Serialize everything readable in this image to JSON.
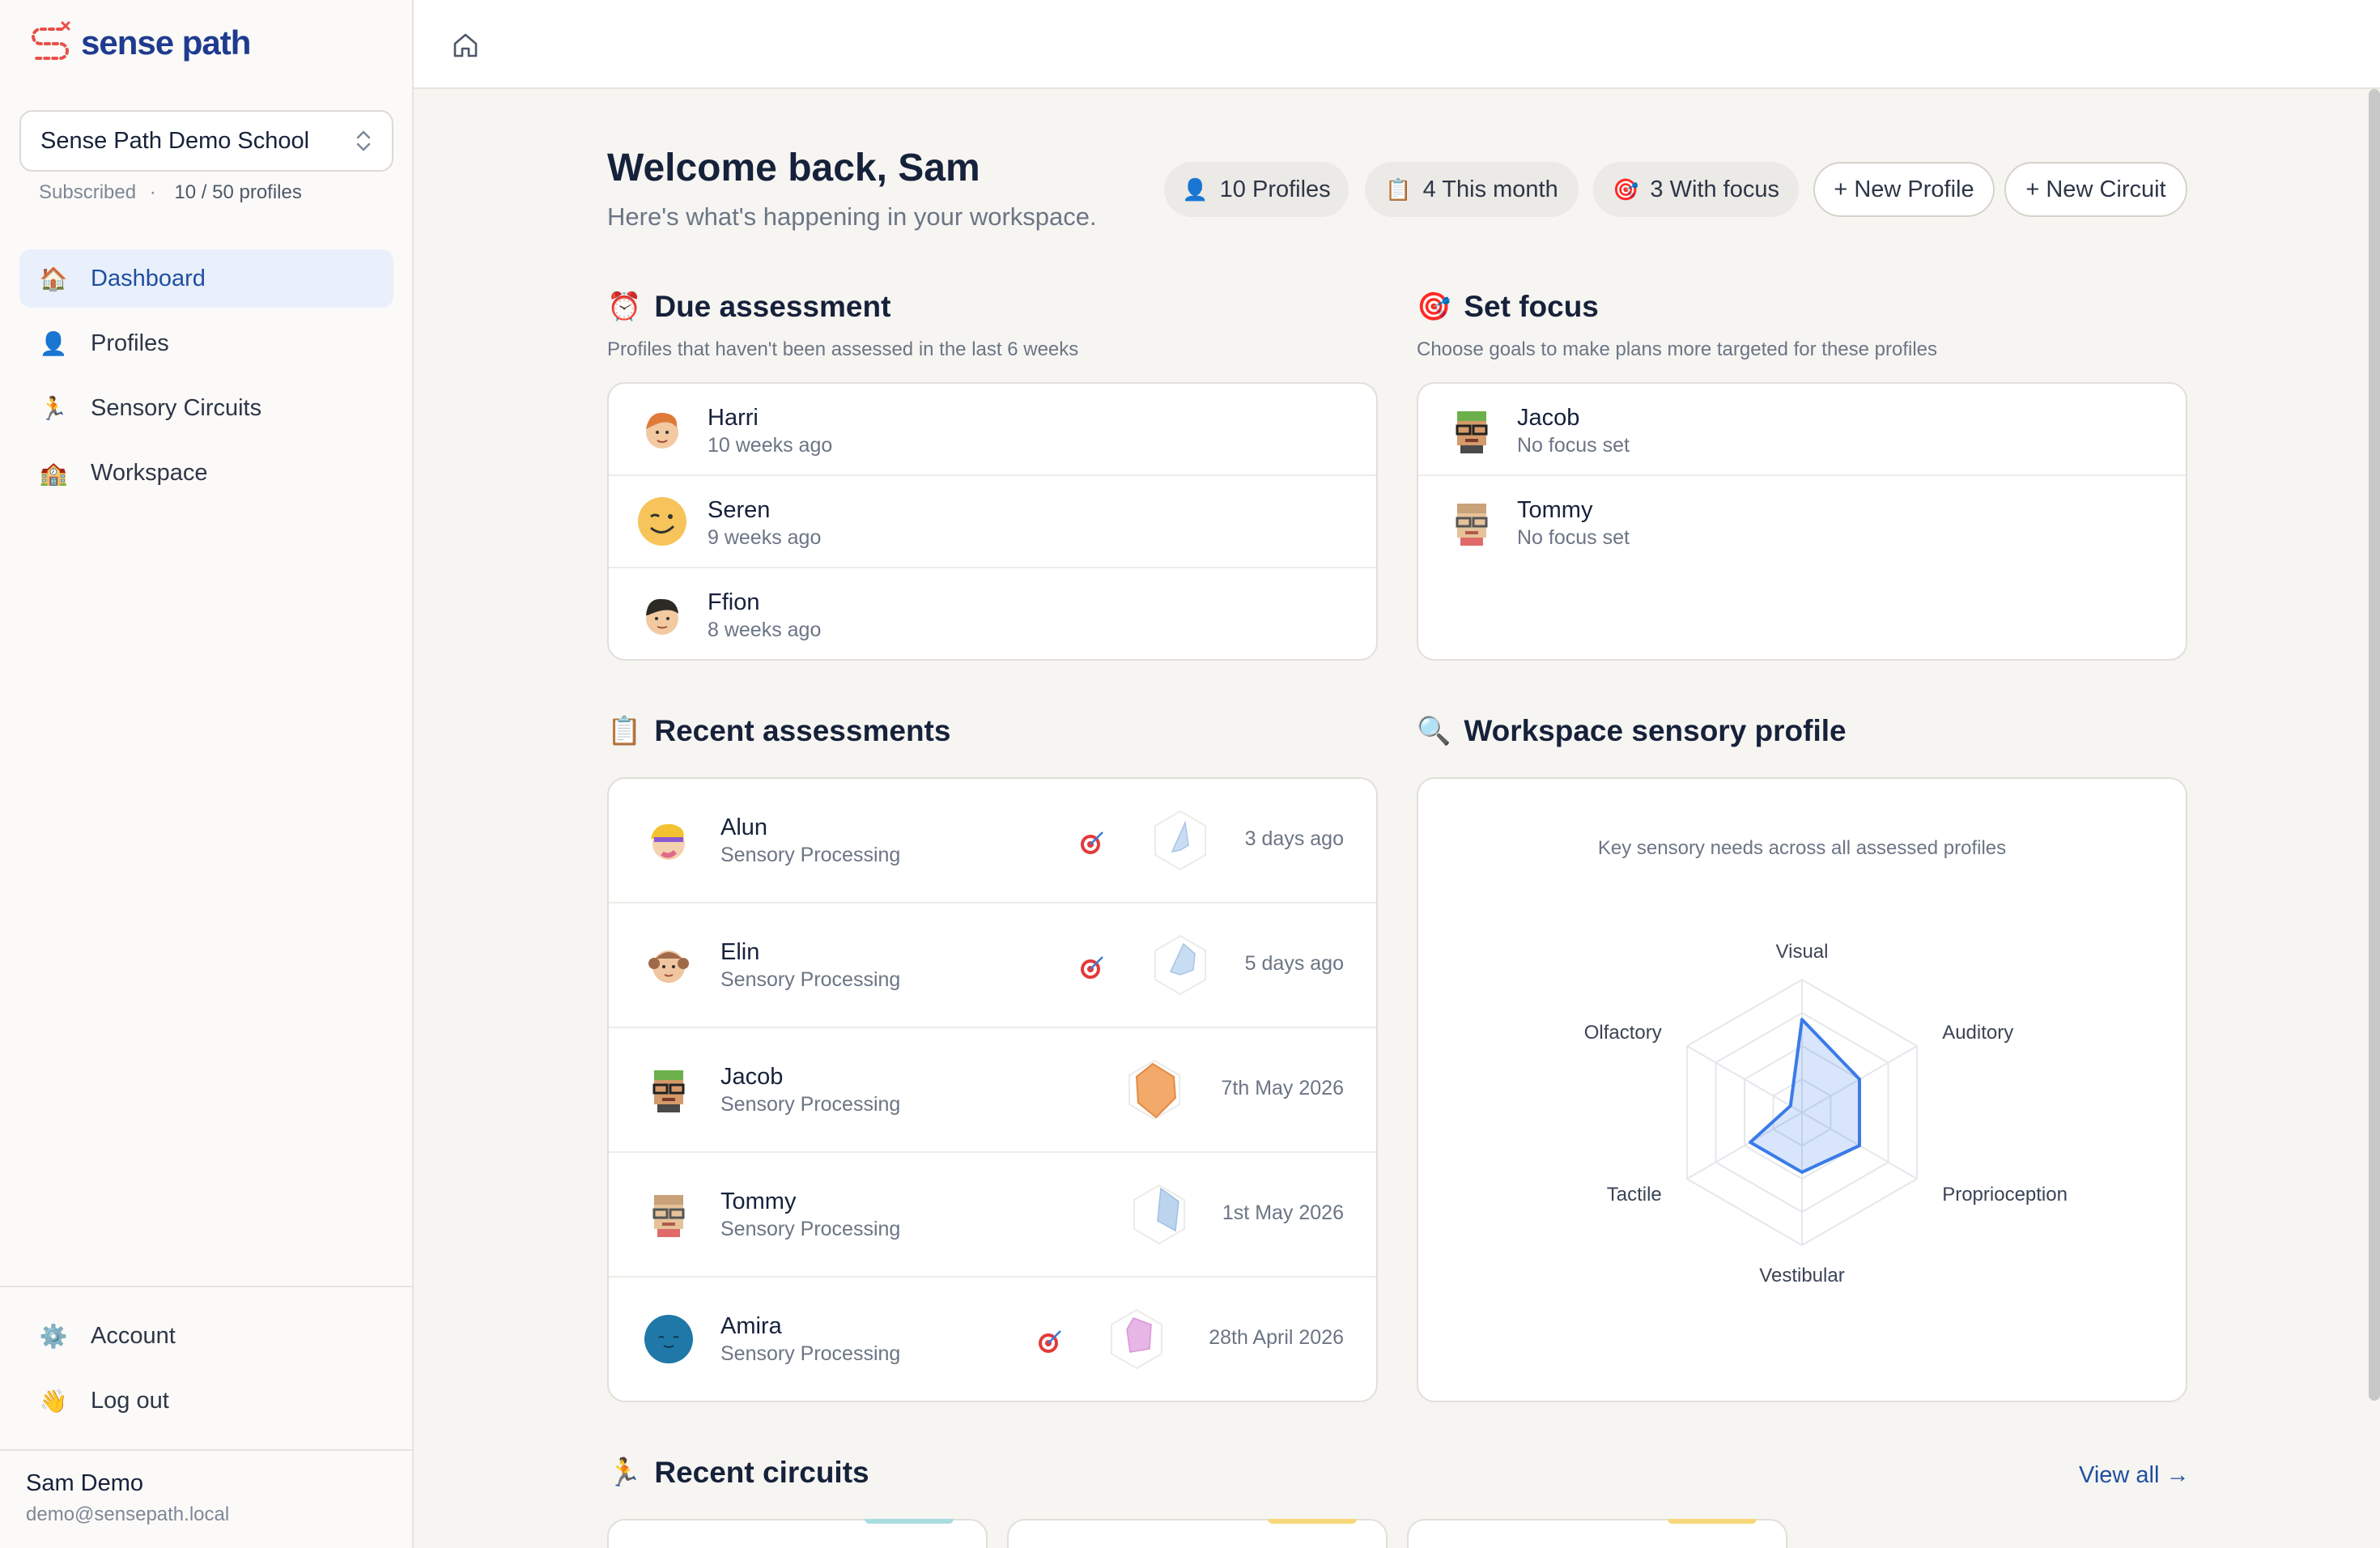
{
  "app": {
    "logo_text": "sense path"
  },
  "sidebar": {
    "school": "Sense Path Demo School",
    "subscription_status": "Subscribed",
    "profile_count": "10 / 50 profiles",
    "nav": [
      {
        "label": "Dashboard",
        "icon": "house-icon",
        "active": true
      },
      {
        "label": "Profiles",
        "icon": "person-icon"
      },
      {
        "label": "Sensory Circuits",
        "icon": "running-person-icon"
      },
      {
        "label": "Workspace",
        "icon": "school-icon"
      }
    ],
    "bottom_nav": [
      {
        "label": "Account",
        "icon": "gear-icon"
      },
      {
        "label": "Log out",
        "icon": "waving-hand-icon"
      }
    ],
    "user": {
      "name": "Sam Demo",
      "email": "demo@sensepath.local"
    }
  },
  "header": {
    "welcome": "Welcome back, Sam",
    "subtitle": "Here's what's happening in your workspace.",
    "stats": [
      {
        "label": "10 Profiles",
        "icon": "person-icon"
      },
      {
        "label": "4 This month",
        "icon": "clipboard-icon"
      },
      {
        "label": "3 With focus",
        "icon": "target-icon"
      }
    ],
    "new_profile": "+ New Profile",
    "new_circuit": "+ New Circuit"
  },
  "due": {
    "title": "Due assessment",
    "desc": "Profiles that haven't been assessed in the last 6 weeks",
    "items": [
      {
        "name": "Harri",
        "sub": "10 weeks ago"
      },
      {
        "name": "Seren",
        "sub": "9 weeks ago"
      },
      {
        "name": "Ffion",
        "sub": "8 weeks ago"
      }
    ]
  },
  "focus": {
    "title": "Set focus",
    "desc": "Choose goals to make plans more targeted for these profiles",
    "items": [
      {
        "name": "Jacob",
        "sub": "No focus set"
      },
      {
        "name": "Tommy",
        "sub": "No focus set"
      }
    ]
  },
  "recent": {
    "title": "Recent assessments",
    "items": [
      {
        "name": "Alun",
        "sub": "Sensory Processing",
        "date": "3 days ago",
        "has_focus": true
      },
      {
        "name": "Elin",
        "sub": "Sensory Processing",
        "date": "5 days ago",
        "has_focus": true
      },
      {
        "name": "Jacob",
        "sub": "Sensory Processing",
        "date": "7th May 2026",
        "has_focus": false
      },
      {
        "name": "Tommy",
        "sub": "Sensory Processing",
        "date": "1st May 2026",
        "has_focus": false
      },
      {
        "name": "Amira",
        "sub": "Sensory Processing",
        "date": "28th April 2026",
        "has_focus": true
      }
    ]
  },
  "workspace_profile": {
    "title": "Workspace sensory profile",
    "desc": "Key sensory needs across all assessed profiles"
  },
  "chart_data": {
    "type": "radar",
    "axes": [
      "Visual",
      "Auditory",
      "Proprioception",
      "Vestibular",
      "Tactile",
      "Olfactory"
    ],
    "values": [
      0.7,
      0.5,
      0.5,
      0.45,
      0.45,
      0.1
    ],
    "range": [
      0,
      1
    ],
    "rings": 4,
    "color": "#3a7be8"
  },
  "circuits": {
    "title": "Recent circuits",
    "view_all": "View all →"
  }
}
